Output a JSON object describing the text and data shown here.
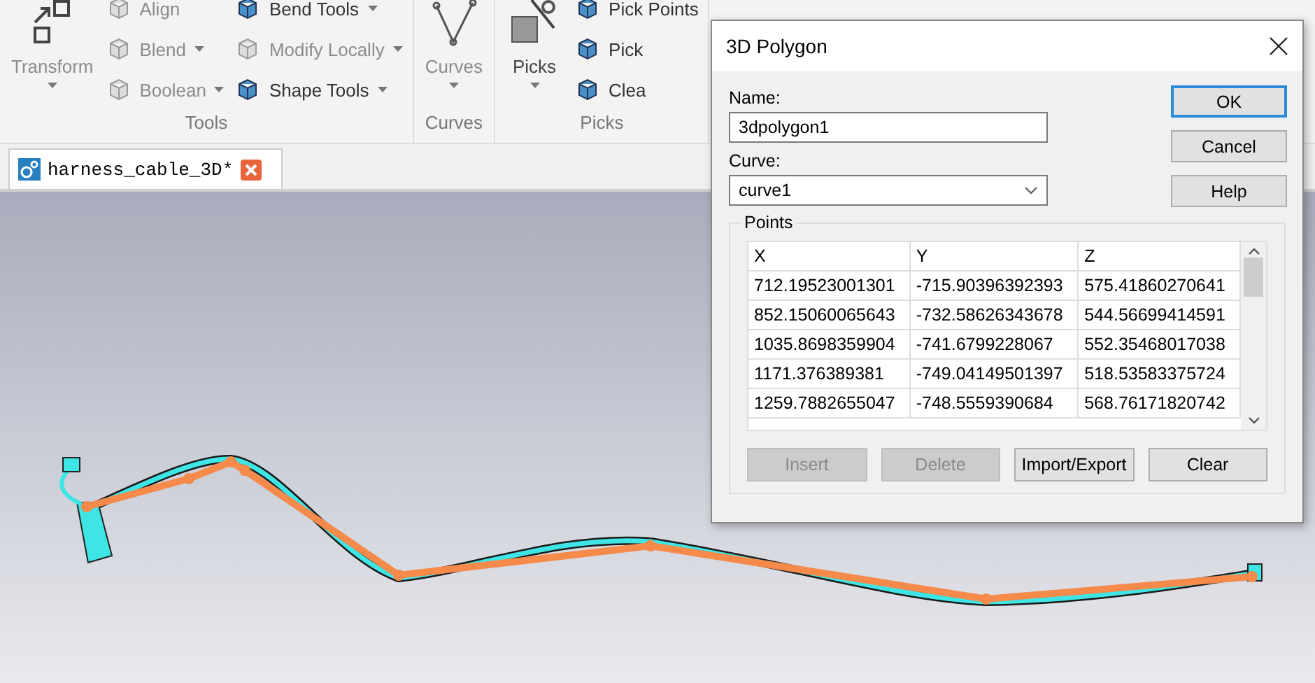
{
  "ribbon": {
    "groups": [
      {
        "label": "Tools",
        "items": [
          {
            "label": "Transform",
            "kind": "large",
            "dropdown": true,
            "disabled": true
          },
          {
            "label": "Align",
            "kind": "small",
            "dropdown": false,
            "disabled": true
          },
          {
            "label": "Blend",
            "kind": "small",
            "dropdown": true,
            "disabled": true
          },
          {
            "label": "Boolean",
            "kind": "small",
            "dropdown": true,
            "disabled": true
          },
          {
            "label": "Bend Tools",
            "kind": "small",
            "dropdown": true,
            "disabled": false
          },
          {
            "label": "Modify Locally",
            "kind": "small",
            "dropdown": true,
            "disabled": true
          },
          {
            "label": "Shape Tools",
            "kind": "small",
            "dropdown": true,
            "disabled": false
          }
        ]
      },
      {
        "label": "Curves",
        "items": [
          {
            "label": "Curves",
            "kind": "large",
            "dropdown": true,
            "disabled": true
          }
        ]
      },
      {
        "label": "Picks",
        "items": [
          {
            "label": "Picks",
            "kind": "large",
            "dropdown": true,
            "disabled": false
          },
          {
            "label": "Pick Points",
            "kind": "small",
            "dropdown": false,
            "disabled": false
          },
          {
            "label": "Pick",
            "kind": "small",
            "dropdown": false,
            "disabled": false
          },
          {
            "label": "Clea",
            "kind": "small",
            "dropdown": false,
            "disabled": false
          }
        ]
      }
    ]
  },
  "tabs": [
    {
      "label": "harness_cable_3D*",
      "selected": true
    }
  ],
  "dialog": {
    "title": "3D Polygon",
    "name_label": "Name:",
    "name_value": "3dpolygon1",
    "curve_label": "Curve:",
    "curve_value": "curve1",
    "points_label": "Points",
    "table": {
      "columns": [
        "X",
        "Y",
        "Z"
      ],
      "rows": [
        [
          "712.19523001301",
          "-715.90396392393",
          "575.41860270641"
        ],
        [
          "852.15060065643",
          "-732.58626343678",
          "544.56699414591"
        ],
        [
          "1035.8698359904",
          "-741.6799228067",
          "552.35468017038"
        ],
        [
          "1171.376389381",
          "-749.04149501397",
          "518.53583375724"
        ],
        [
          "1259.7882655047",
          "-748.5559390684",
          "568.76171820742"
        ]
      ]
    },
    "table_buttons": [
      {
        "label": "Insert",
        "disabled": true
      },
      {
        "label": "Delete",
        "disabled": true
      },
      {
        "label": "Import/Export",
        "disabled": false
      },
      {
        "label": "Clear",
        "disabled": false
      }
    ],
    "side_buttons": [
      {
        "label": "OK",
        "default": true
      },
      {
        "label": "Cancel",
        "default": false
      },
      {
        "label": "Help",
        "default": false
      }
    ]
  }
}
